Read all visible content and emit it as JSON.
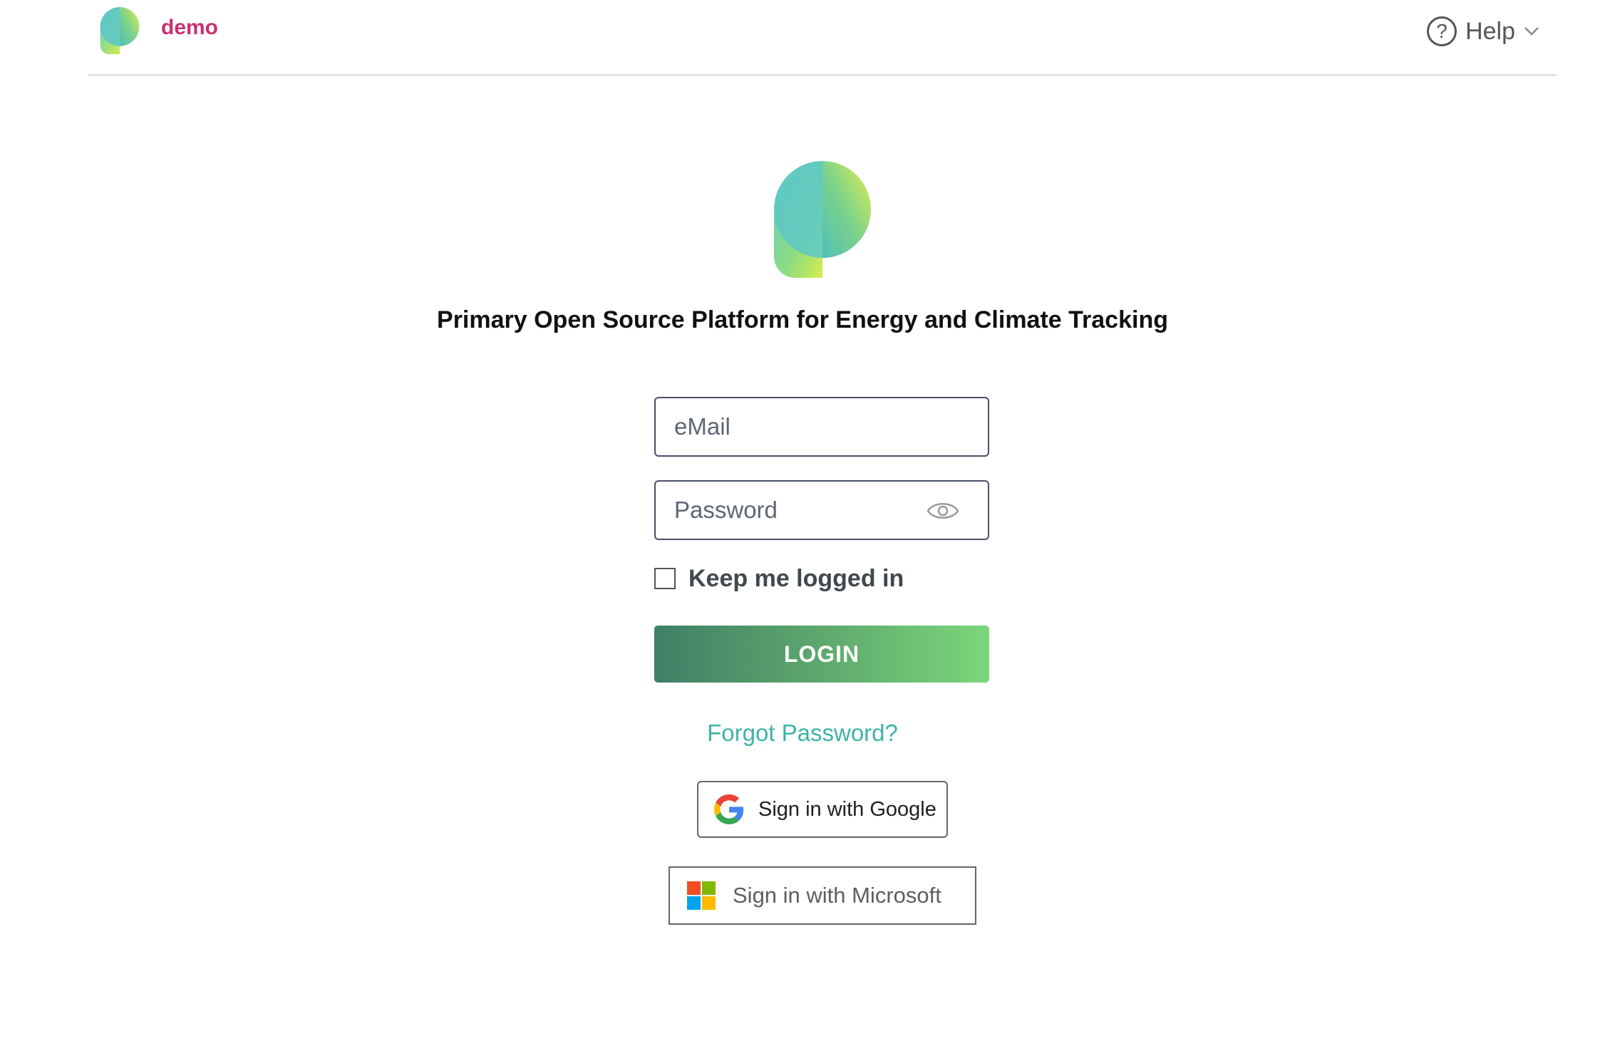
{
  "header": {
    "tenant": "demo",
    "help_label": "Help"
  },
  "main": {
    "tagline": "Primary Open Source Platform for Energy and Climate Tracking"
  },
  "login_form": {
    "email_placeholder": "eMail",
    "email_value": "",
    "password_placeholder": "Password",
    "password_value": "",
    "keep_logged_in_label": "Keep me logged in",
    "keep_logged_in_checked": false,
    "login_label": "LOGIN",
    "forgot_password_label": "Forgot Password?"
  },
  "sso": {
    "google_label": "Sign in with Google",
    "microsoft_label": "Sign in with Microsoft"
  },
  "icons": {
    "brand_logo": "brand-logo-icon",
    "help": "question-circle-icon",
    "help_chevron": "chevron-down-icon",
    "password_toggle": "eye-icon",
    "google": "google-g-icon",
    "microsoft": "microsoft-squares-icon"
  },
  "colors": {
    "tenant_text": "#c9306f",
    "tagline_text": "#111111",
    "login_gradient_start": "#3f7f66",
    "login_gradient_end": "#7bd67a",
    "forgot_link": "#3fb3a8",
    "input_border": "#4a4f6a",
    "logo_teal": "#5ec8c4",
    "logo_lime": "#d8ef4b",
    "microsoft_red": "#f25022",
    "microsoft_green": "#7fba00",
    "microsoft_blue": "#00a4ef",
    "microsoft_yellow": "#ffb900"
  }
}
